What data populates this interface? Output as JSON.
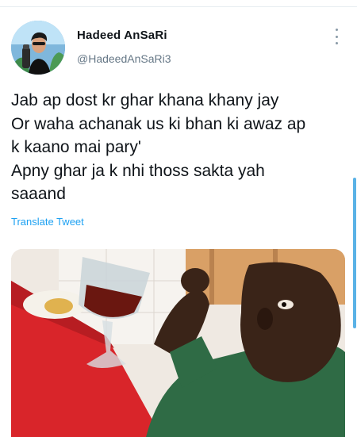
{
  "tweet": {
    "author": {
      "display_name": "Hadeed AnSaRi",
      "handle": "@HadeedAnSaRi3"
    },
    "text_lines": [
      "Jab ap dost kr ghar khana khany jay",
      "Or waha achanak  us ki bhan ki awaz ap",
      "k kaano mai pary'",
      "Apny ghar ja k nhi thoss sakta yah",
      "saaand"
    ],
    "translate_label": "Translate Tweet",
    "more_icon": "more-vertical-icon"
  },
  "colors": {
    "link": "#1da1f2",
    "secondary_text": "#657786",
    "primary_text": "#0f1419",
    "scroll_indicator": "#5ab2e6"
  }
}
